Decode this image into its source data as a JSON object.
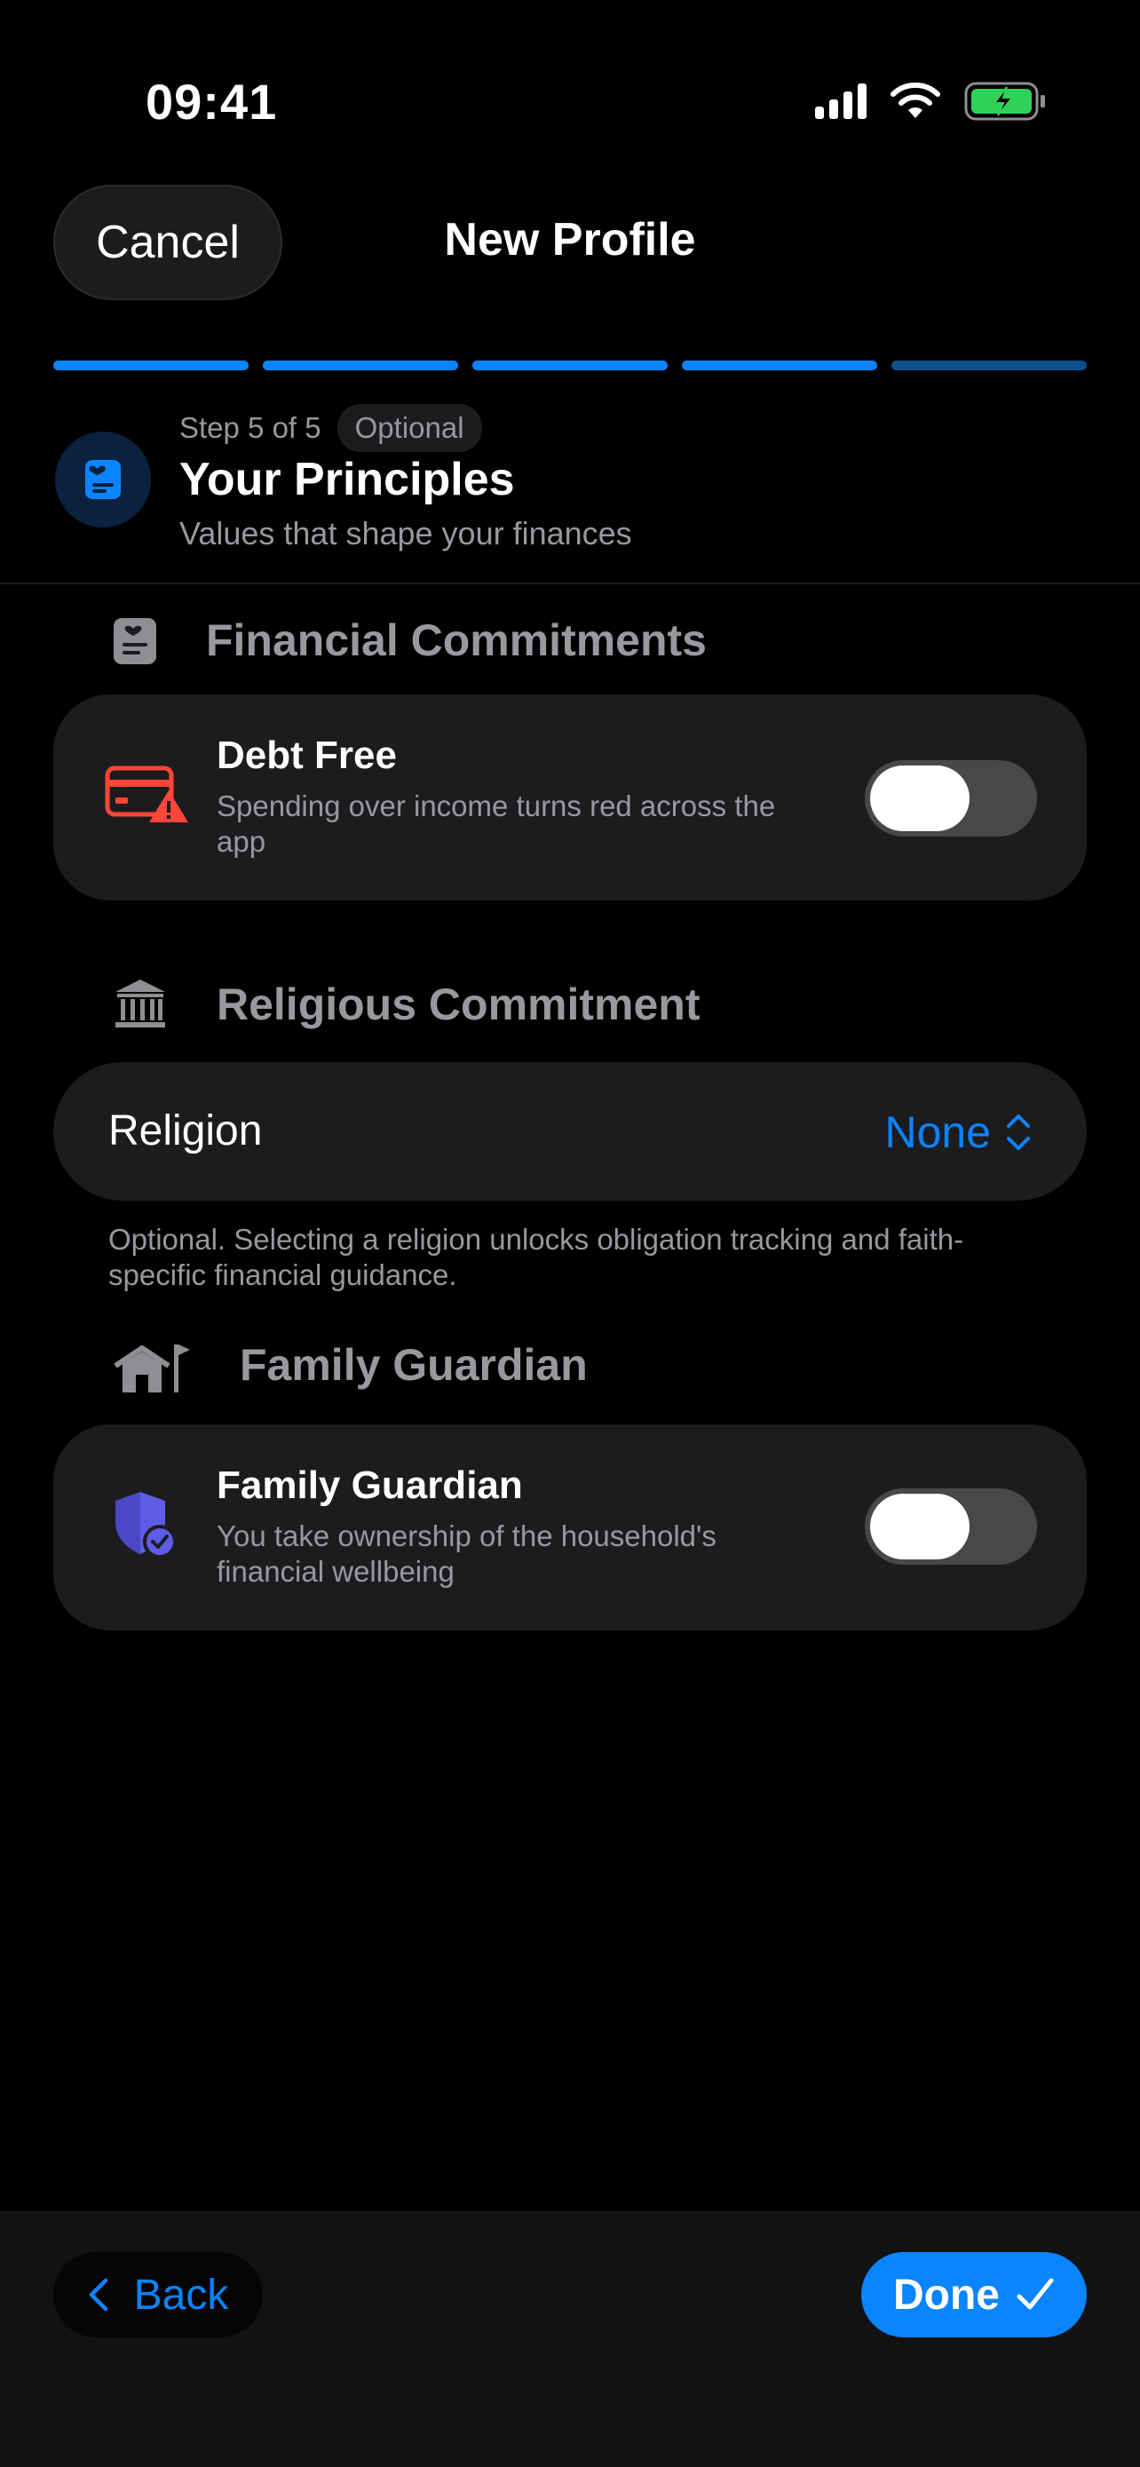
{
  "status_bar": {
    "time": "09:41"
  },
  "header": {
    "cancel_label": "Cancel",
    "title": "New Profile"
  },
  "progress": {
    "total_steps": 5,
    "current_step": 5,
    "colors": [
      "#0a84ff",
      "#0a84ff",
      "#0a84ff",
      "#0a84ff",
      "#0b4f8f"
    ]
  },
  "step": {
    "label": "Step 5 of 5",
    "badge": "Optional",
    "title": "Your Principles",
    "subtitle": "Values that shape your finances",
    "icon": "heart-document-icon"
  },
  "sections": {
    "financial": {
      "title": "Financial Commitments",
      "icon": "document-icon",
      "row": {
        "title": "Debt Free",
        "subtitle": "Spending over income turns red across the app",
        "icon": "credit-card-warning-icon",
        "toggle_on": false
      }
    },
    "religious": {
      "title": "Religious Commitment",
      "icon": "building-columns-icon",
      "row": {
        "label": "Religion",
        "value": "None"
      },
      "footnote": "Optional. Selecting a religion unlocks obligation tracking and faith-specific financial guidance."
    },
    "guardian": {
      "title": "Family Guardian",
      "icon": "house-flag-icon",
      "row": {
        "title": "Family Guardian",
        "subtitle": "You take ownership of the household's financial wellbeing",
        "icon": "shield-check-icon",
        "toggle_on": false
      }
    }
  },
  "footer": {
    "back_label": "Back",
    "done_label": "Done"
  },
  "colors": {
    "accent": "#0a84ff",
    "danger": "#ff453a",
    "purple": "#5e5ce6",
    "card": "#1c1c1e"
  }
}
